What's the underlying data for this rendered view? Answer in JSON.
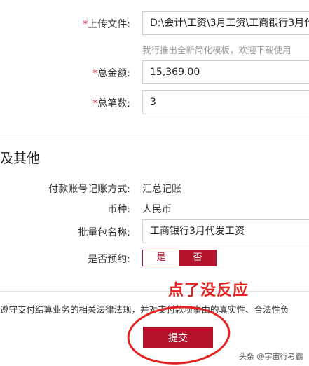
{
  "form": {
    "upload": {
      "required_mark": "*",
      "label": "上传文件:",
      "value": "D:\\会计\\工资\\3月工资\\工商银行3月代",
      "hint": "我行推出全新简化模板，欢迎下载使用"
    },
    "total_amount": {
      "required_mark": "*",
      "label": "总金额:",
      "value": "15,369.00"
    },
    "total_count": {
      "required_mark": "*",
      "label": "总笔数:",
      "value": "3"
    }
  },
  "other_section": {
    "title": "及其他",
    "posting_method": {
      "label": "付款账号记账方式:",
      "value": "汇总记账"
    },
    "currency": {
      "label": "币种:",
      "value": "人民币"
    },
    "batch_name": {
      "label": "批量包名称:",
      "value": "工商银行3月代发工资"
    },
    "reservation": {
      "label": "是否预约:",
      "options": [
        "是",
        "否"
      ],
      "selected": "否"
    }
  },
  "agreement_text": "遵守支付结算业务的相关法律法规，并对支付款项事由的真实性、合法性负",
  "submit_label": "提交",
  "annotation_text": "点了没反应",
  "watermark": "头条 @宇宙行考霸",
  "colors": {
    "accent": "#b5122d",
    "annotation": "#e52222"
  }
}
